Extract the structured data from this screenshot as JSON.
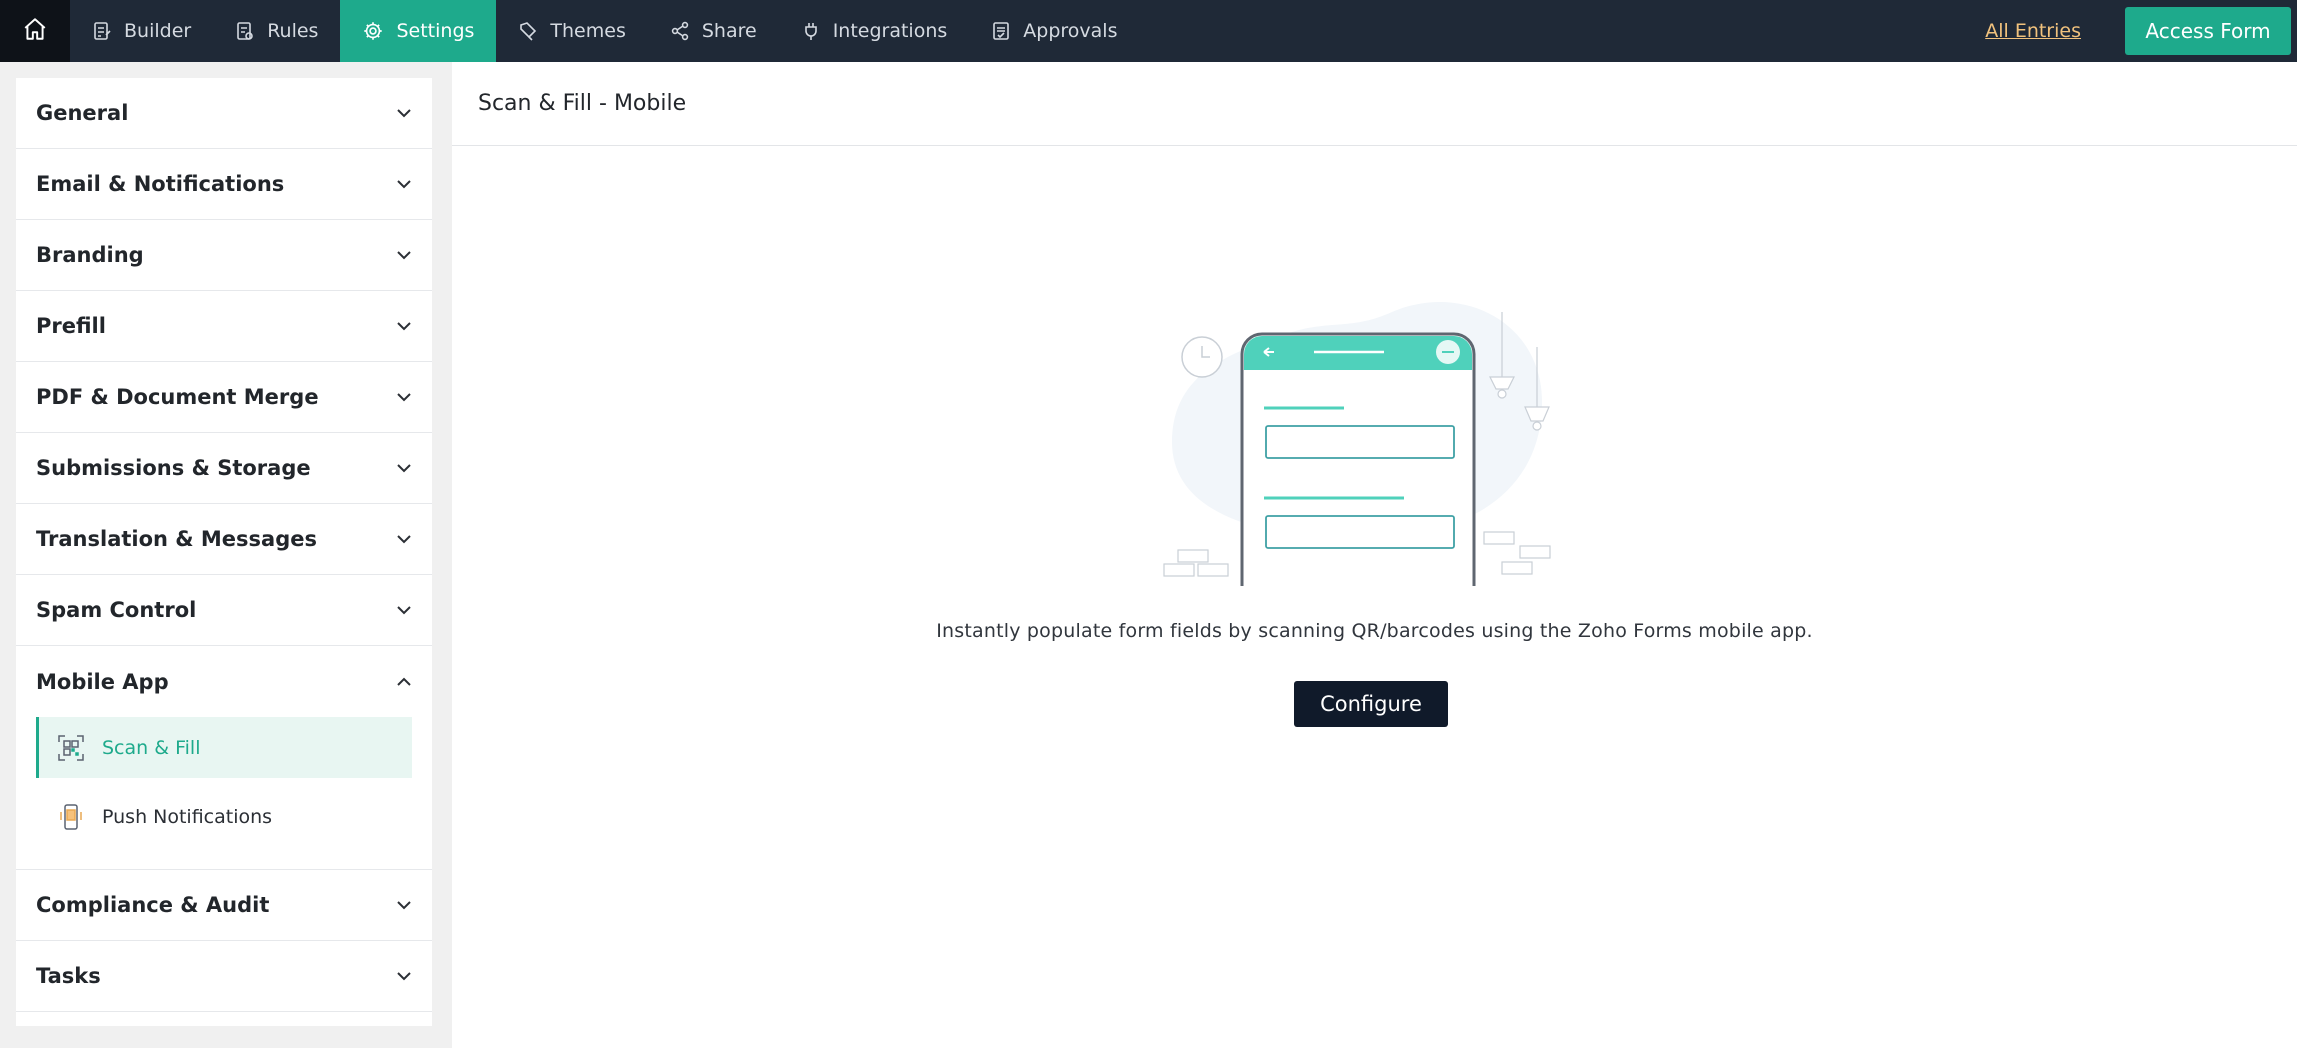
{
  "topbar": {
    "home_icon": "home-icon",
    "tabs": [
      {
        "label": "Builder",
        "icon": "form-icon"
      },
      {
        "label": "Rules",
        "icon": "rules-icon"
      },
      {
        "label": "Settings",
        "icon": "gear-icon",
        "active": true
      },
      {
        "label": "Themes",
        "icon": "brush-icon"
      },
      {
        "label": "Share",
        "icon": "share-icon"
      },
      {
        "label": "Integrations",
        "icon": "plug-icon"
      },
      {
        "label": "Approvals",
        "icon": "approval-icon"
      }
    ],
    "all_entries": "All Entries",
    "access_form": "Access Form"
  },
  "sidebar": {
    "sections": [
      {
        "label": "General"
      },
      {
        "label": "Email & Notifications"
      },
      {
        "label": "Branding"
      },
      {
        "label": "Prefill"
      },
      {
        "label": "PDF & Document Merge"
      },
      {
        "label": "Submissions & Storage"
      },
      {
        "label": "Translation & Messages"
      },
      {
        "label": "Spam Control"
      },
      {
        "label": "Mobile App",
        "expanded": true
      },
      {
        "label": "Compliance & Audit"
      },
      {
        "label": "Tasks"
      }
    ],
    "mobile_app_items": [
      {
        "label": "Scan & Fill",
        "icon": "qr-scan-icon",
        "active": true
      },
      {
        "label": "Push Notifications",
        "icon": "mobile-notification-icon"
      }
    ]
  },
  "main": {
    "title": "Scan & Fill - Mobile",
    "description": "Instantly populate form fields by scanning QR/barcodes using the Zoho Forms mobile app.",
    "configure_label": "Configure"
  },
  "colors": {
    "topbar": "#1f2937",
    "accent": "#1eaa8c",
    "link": "#f1c27d",
    "button_dark": "#101a2a"
  }
}
